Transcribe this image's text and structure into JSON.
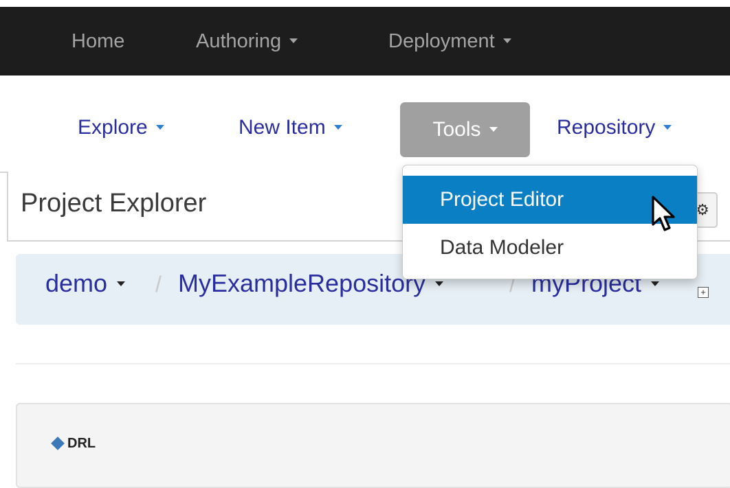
{
  "topnav": {
    "home": "Home",
    "authoring": "Authoring",
    "deployment": "Deployment"
  },
  "subnav": {
    "explore": "Explore",
    "new_item": "New Item",
    "tools": "Tools",
    "repository": "Repository"
  },
  "tools_menu": {
    "items": [
      "Project Editor",
      "Data Modeler"
    ],
    "selected": "Project Editor"
  },
  "explorer": {
    "title": "Project Explorer",
    "settings_icon": "gear-icon"
  },
  "breadcrumb": {
    "org": "demo",
    "repository": "MyExampleRepository",
    "project": "myProject",
    "separator": "/",
    "expand_icon": "plus-box-icon"
  },
  "panel": {
    "label": "DRL",
    "icon": "diamond-icon"
  },
  "colors": {
    "topbar": "#1d1d1d",
    "link": "#2a2d9e",
    "active_item": "#0a7fc4",
    "tools_button": "#a0a0a0",
    "breadcrumb_bg": "#e6eff5"
  }
}
